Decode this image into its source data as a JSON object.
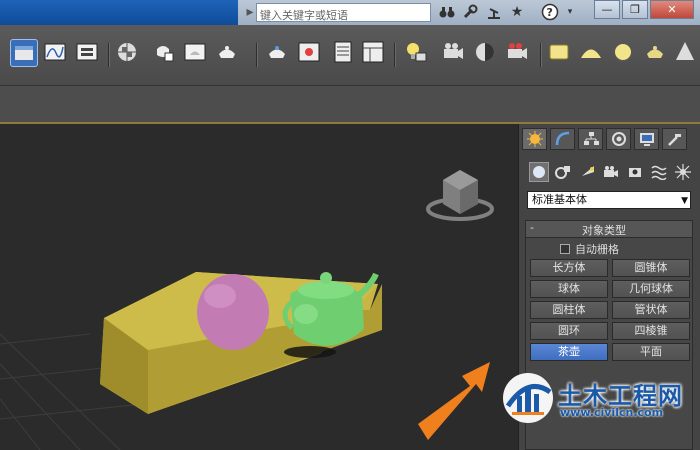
{
  "search": {
    "placeholder": "键入关键字或短语"
  },
  "title_icons": [
    "binoculars-icon",
    "wrench-icon",
    "satellite-icon",
    "star-icon",
    "help-icon"
  ],
  "window_controls": {
    "minimize": "—",
    "restore": "❐",
    "close": "✕"
  },
  "toolbar": {
    "groups": [
      [
        "scene-explorer-icon",
        "curve-editor-icon",
        "schematic-view-icon"
      ],
      [
        "material-editor-icon",
        "render-setup-icon",
        "rendered-frame-icon",
        "render-icon"
      ],
      [
        "teapot-render-icon",
        "render-frame-window-icon",
        "grid-panel-icon",
        "layout-panel-icon"
      ],
      [
        "light-bulb-icon",
        "camera-icon",
        "head-icon",
        "camera-red-icon"
      ],
      [
        "plane-icon",
        "dome-icon",
        "sphere-icon",
        "teapot-icon",
        "cone-icon"
      ]
    ]
  },
  "panel": {
    "tabs": [
      "create-tab-icon",
      "modify-tab-icon",
      "hierarchy-tab-icon",
      "motion-tab-icon",
      "display-tab-icon",
      "utilities-tab-icon"
    ],
    "subtabs": [
      "geometry-icon",
      "shapes-icon",
      "lights-icon",
      "cameras-icon",
      "helpers-icon",
      "space-warps-icon",
      "systems-icon"
    ],
    "dropdown": "标准基本体",
    "rollout": {
      "collapse": "-",
      "title": "对象类型",
      "autogrid": "自动栅格",
      "buttons": [
        "长方体",
        "圆锥体",
        "球体",
        "几何球体",
        "圆柱体",
        "管状体",
        "圆环",
        "四棱锥",
        "茶壶",
        "平面"
      ],
      "selected": "茶壶"
    }
  },
  "colors": {
    "box": "#c9b544",
    "sphere": "#c27bb3",
    "teapot": "#6fce6f",
    "arrow": "#f07f1e",
    "selected_button": "#4a78cc"
  },
  "watermark": {
    "title": "土木工程网",
    "url": "www.civilcn.com"
  }
}
